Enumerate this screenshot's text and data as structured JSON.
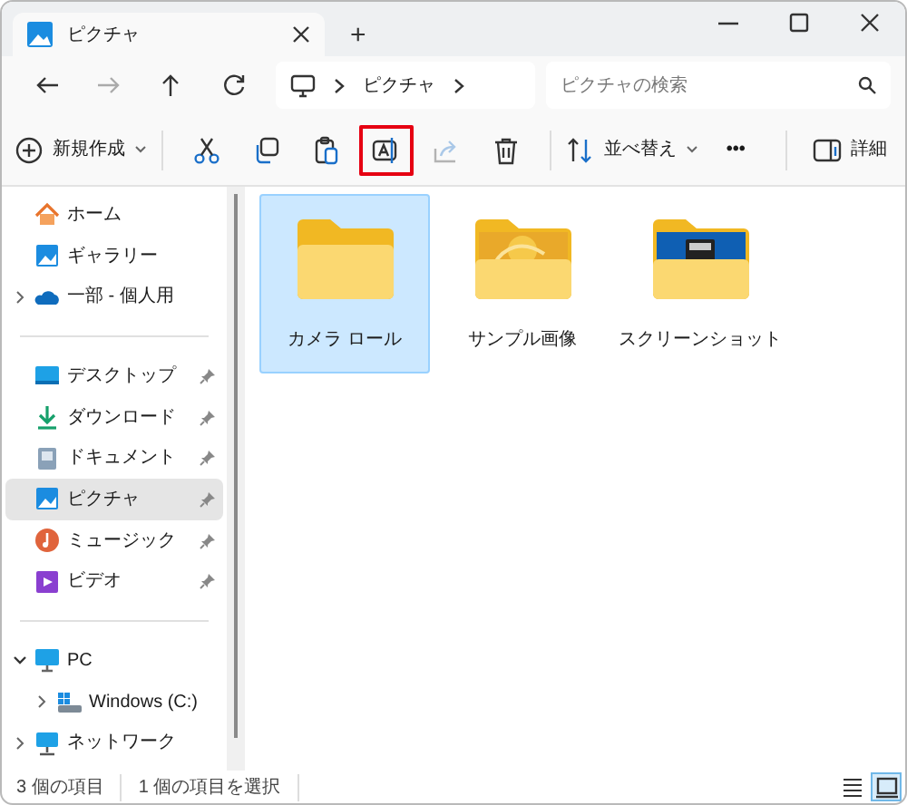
{
  "tab": {
    "title": "ピクチャ",
    "new_tab": "+"
  },
  "address": {
    "crumbs": [
      "ピクチャ"
    ],
    "search_placeholder": "ピクチャの検索"
  },
  "toolbar": [
    {
      "kind": "new",
      "label": "新規作成",
      "disabled": false,
      "highlighted": false
    },
    {
      "kind": "cut",
      "disabled": false,
      "highlighted": false
    },
    {
      "kind": "copy",
      "disabled": false,
      "highlighted": false
    },
    {
      "kind": "paste",
      "disabled": false,
      "highlighted": false
    },
    {
      "kind": "rename",
      "disabled": false,
      "highlighted": true
    },
    {
      "kind": "share",
      "disabled": true,
      "highlighted": false
    },
    {
      "kind": "delete",
      "disabled": false,
      "highlighted": false
    },
    {
      "kind": "sort",
      "label": "並べ替え",
      "disabled": false,
      "highlighted": false
    },
    {
      "kind": "more",
      "label": "•••",
      "disabled": false,
      "highlighted": false
    },
    {
      "kind": "details",
      "label": "詳細",
      "disabled": false,
      "highlighted": false
    }
  ],
  "sidebar": [
    [
      {
        "label": "ホーム",
        "kind": "home",
        "selected": false,
        "pinned": false
      },
      {
        "label": "ギャラリー",
        "kind": "gallery",
        "selected": false,
        "pinned": false
      },
      {
        "label": "一部 - 個人用",
        "kind": "cloud",
        "selected": false,
        "pinned": false,
        "expanded": false
      }
    ],
    [
      {
        "label": "デスクトップ",
        "kind": "desktop",
        "selected": false,
        "pinned": true
      },
      {
        "label": "ダウンロード",
        "kind": "download",
        "selected": false,
        "pinned": true
      },
      {
        "label": "ドキュメント",
        "kind": "document",
        "selected": false,
        "pinned": true
      },
      {
        "label": "ピクチャ",
        "kind": "pictures",
        "selected": true,
        "pinned": true
      },
      {
        "label": "ミュージック",
        "kind": "music",
        "selected": false,
        "pinned": true
      },
      {
        "label": "ビデオ",
        "kind": "video",
        "selected": false,
        "pinned": true
      }
    ],
    [
      {
        "label": "PC",
        "kind": "pc",
        "selected": false,
        "pinned": false,
        "expanded": true,
        "children": [
          {
            "label": "Windows (C:)",
            "kind": "drive",
            "selected": false,
            "pinned": false,
            "expanded": false
          }
        ]
      },
      {
        "label": "ネットワーク",
        "kind": "network",
        "selected": false,
        "pinned": false,
        "expanded": false
      }
    ]
  ],
  "items": [
    {
      "label": "カメラ ロール",
      "kind": "plain",
      "selected": true
    },
    {
      "label": "サンプル画像",
      "kind": "photo",
      "selected": false
    },
    {
      "label": "スクリーンショット",
      "kind": "screenshot",
      "selected": false
    }
  ],
  "status_bar": {
    "texts": [
      "3 個の項目",
      "1 個の項目を選択"
    ],
    "views": [
      {
        "kind": "list",
        "selected": false
      },
      {
        "kind": "tiles",
        "selected": true
      }
    ]
  }
}
